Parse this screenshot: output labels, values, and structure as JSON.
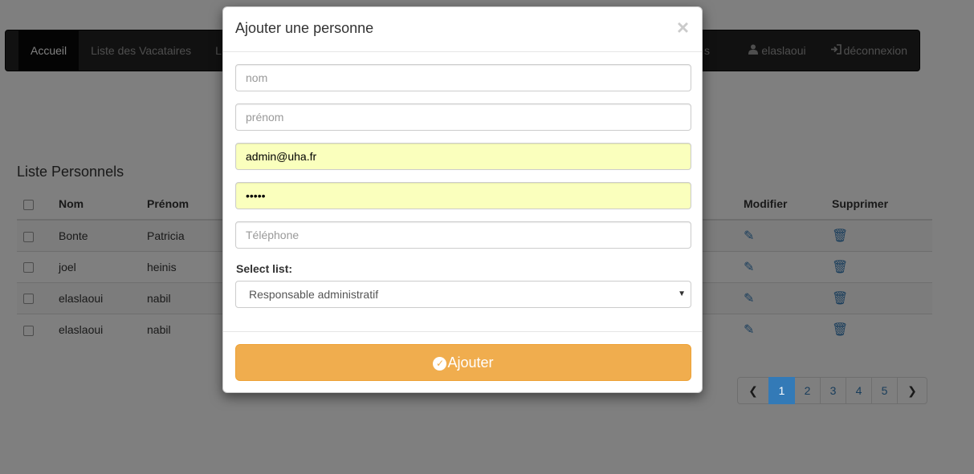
{
  "navbar": {
    "items": [
      {
        "label": "Accueil",
        "active": true
      },
      {
        "label": "Liste des Vacataires",
        "active": false
      },
      {
        "label": "L",
        "active": false
      }
    ],
    "hidden_right_fragment": "s",
    "user": {
      "icon": "user-icon",
      "label": "elaslaoui"
    },
    "logout": {
      "icon": "logout-icon",
      "label": "déconnexion"
    }
  },
  "content": {
    "list_title": "Liste Personnels",
    "table": {
      "headers": {
        "nom": "Nom",
        "prenom": "Prénom",
        "modifier": "Modifier",
        "supprimer": "Supprimer"
      },
      "rows": [
        {
          "nom": "Bonte",
          "prenom": "Patricia"
        },
        {
          "nom": "joel",
          "prenom": "heinis"
        },
        {
          "nom": "elaslaoui",
          "prenom": "nabil"
        },
        {
          "nom": "elaslaoui",
          "prenom": "nabil"
        }
      ]
    },
    "pagination": {
      "pages": [
        "1",
        "2",
        "3",
        "4",
        "5"
      ],
      "active": "1",
      "prev_icon": "chevron-left-icon",
      "next_icon": "chevron-right-icon"
    }
  },
  "modal": {
    "title": "Ajouter une personne",
    "close_symbol": "×",
    "fields": {
      "nom": {
        "placeholder": "nom",
        "value": ""
      },
      "prenom": {
        "placeholder": "prénom",
        "value": ""
      },
      "email": {
        "placeholder": "",
        "value": "admin@uha.fr"
      },
      "password": {
        "placeholder": "",
        "value": "•••••"
      },
      "telephone": {
        "placeholder": "Téléphone",
        "value": ""
      }
    },
    "select_label": "Select list:",
    "select_value": "Responsable administratif",
    "submit_label": "Ajouter",
    "colors": {
      "submit": "#f0ad4e",
      "autofill": "#faffbd",
      "accent": "#337ab7"
    }
  }
}
